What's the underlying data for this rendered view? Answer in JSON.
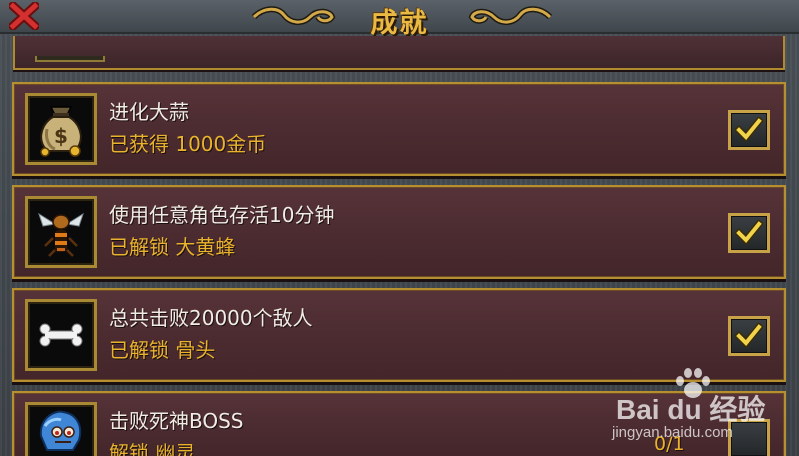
{
  "header": {
    "title": "成就",
    "close_icon": "close-x-icon",
    "accent": "#e9b944"
  },
  "achievements": [
    {
      "title": "进化大蒜",
      "reward": "已获得 1000金币",
      "icon": "money-bag-icon",
      "completed": true
    },
    {
      "title": "使用任意角色存活10分钟",
      "reward": "已解锁 大黄蜂",
      "icon": "hornet-icon",
      "completed": true
    },
    {
      "title": "总共击败20000个敌人",
      "reward": "已解锁 骨头",
      "icon": "bone-icon",
      "completed": true
    },
    {
      "title": "击败死神BOSS",
      "reward": "解锁 幽灵",
      "icon": "ghost-icon",
      "completed": false,
      "progress": "0/1"
    }
  ],
  "colors": {
    "row_border": "#b68f31",
    "reward_text": "#e9b32d",
    "check": "#f0d34a"
  },
  "watermark": {
    "brand": "Bai du 经验",
    "url": "jingyan.baidu.com"
  }
}
